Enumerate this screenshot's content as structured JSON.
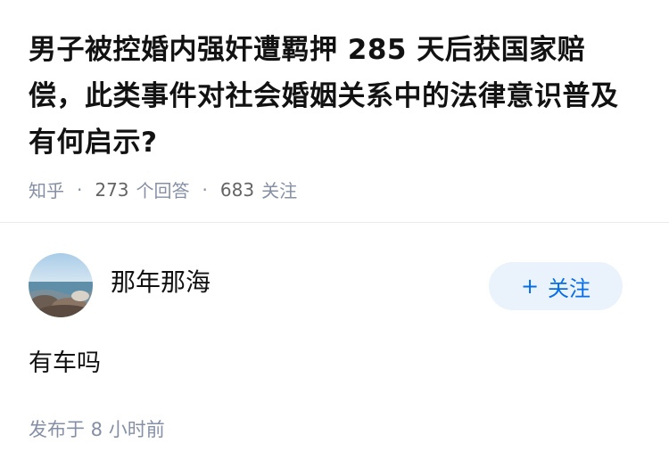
{
  "question": {
    "title": "男子被控婚内强奸遭羁押 285 天后获国家赔偿，此类事件对社会婚姻关系中的法律意识普及有何启示?",
    "source": "知乎",
    "separator": "·",
    "answer_count": "273",
    "answer_label": "个回答",
    "follow_count": "683",
    "follow_label": "关注"
  },
  "answer": {
    "author_name": "那年那海",
    "follow_button": {
      "icon": "plus-icon",
      "plus": "+",
      "label": "关注"
    },
    "content": "有车吗",
    "published": "发布于  8 小时前"
  },
  "colors": {
    "accent": "#056de8",
    "follow_bg": "#eaf2fb",
    "meta_text": "#8590a6",
    "title_text": "#121212"
  }
}
